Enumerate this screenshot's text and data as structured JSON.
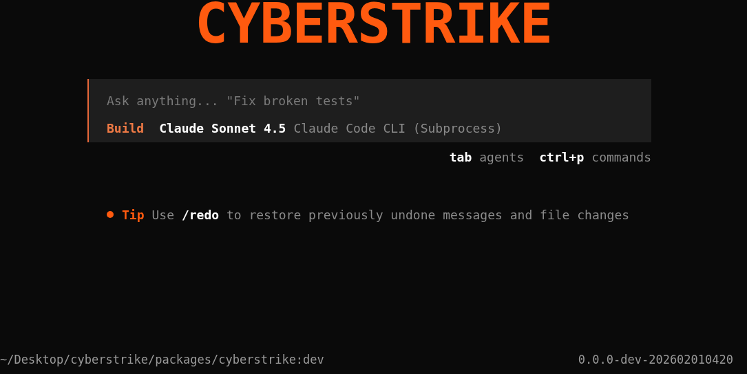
{
  "logo": "CYBERSTRIKE",
  "prompt": {
    "placeholder": "Ask anything... \"Fix broken tests\"",
    "agent": "Build",
    "model": "Claude Sonnet 4.5",
    "provider": "Claude Code CLI (Subprocess)"
  },
  "shortcuts": [
    {
      "key": "tab",
      "label": "agents"
    },
    {
      "key": "ctrl+p",
      "label": "commands"
    }
  ],
  "tip": {
    "label": "Tip",
    "text": "Use **/redo** to restore previously undone messages and file changes"
  },
  "status_bar": {
    "path": "~/Desktop/cyberstrike/packages/cyberstrike:dev",
    "version": "0.0.0-dev-202602010420"
  }
}
